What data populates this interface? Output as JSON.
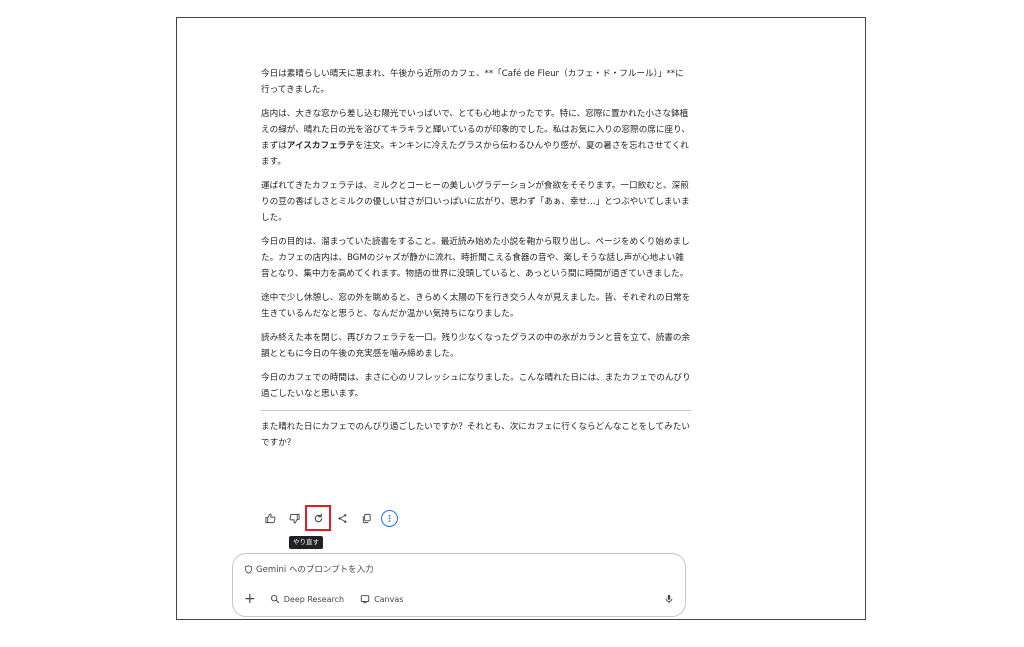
{
  "chat": {
    "paragraphs": [
      "今日は素晴らしい晴天に恵まれ、午後から近所のカフェ、**「Café de Fleur（カフェ・ド・フルール）」**に行ってきました。",
      "店内は、大きな窓から差し込む陽光でいっぱいで、とても心地よかったです。特に、窓際に置かれた小さな鉢植えの緑が、晴れた日の光を浴びてキラキラと輝いているのが印象的でした。私はお気に入りの窓際の席に座り、まずは",
      "運ばれてきたカフェラテは、ミルクとコーヒーの美しいグラデーションが食欲をそそります。一口飲むと、深煎りの豆の香ばしさとミルクの優しい甘さが口いっぱいに広がり、思わず「あぁ、幸せ…」とつぶやいてしまいました。",
      "今日の目的は、溜まっていた読書をすること。最近読み始めた小説を鞄から取り出し、ページをめくり始めました。カフェの店内は、BGMのジャズが静かに流れ、時折聞こえる食器の音や、楽しそうな話し声が心地よい雑音となり、集中力を高めてくれます。物語の世界に没頭していると、あっという間に時間が過ぎていきました。",
      "途中で少し休憩し、窓の外を眺めると、きらめく太陽の下を行き交う人々が見えました。皆、それぞれの日常を生きているんだなと思うと、なんだか温かい気持ちになりました。",
      "読み終えた本を閉じ、再びカフェラテを一口。残り少なくなったグラスの中の氷がカランと音を立て、読書の余韻とともに今日の午後の充実感を噛み締めました。",
      "今日のカフェでの時間は、まさに心のリフレッシュになりました。こんな晴れた日には、またカフェでのんびり過ごしたいなと思います。",
      "また晴れた日にカフェでのんびり過ごしたいですか？それとも、次にカフェに行くならどんなことをしてみたいですか？"
    ],
    "p2_bold": "アイスカフェラテ",
    "p2_after": "を注文。キンキンに冷えたグラスから伝わるひんやり感が、夏の暑さを忘れさせてくれます。"
  },
  "actions": {
    "tooltip": "やり直す",
    "icons": [
      "thumbs-up-icon",
      "thumbs-down-icon",
      "redo-icon",
      "share-icon",
      "copy-icon",
      "more-options-icon"
    ]
  },
  "prompt": {
    "placeholder": "Gemini へのプロンプトを入力",
    "deep_research": "Deep Research",
    "canvas": "Canvas"
  },
  "colors": {
    "highlight": "#e51c23",
    "accent": "#1a73e8",
    "text": "#1f1f1f"
  }
}
